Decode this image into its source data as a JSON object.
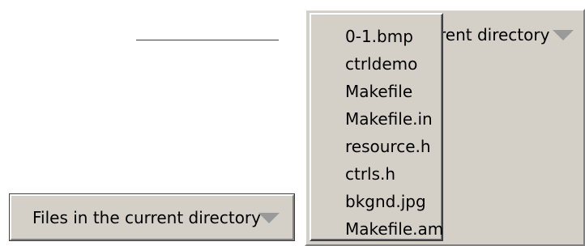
{
  "closed_dropdown": {
    "label": "Files in the current directory",
    "arrow_icon": "triangle-down-icon"
  },
  "open_dropdown": {
    "label_visible": "rent directory",
    "arrow_icon": "triangle-down-icon",
    "items": [
      {
        "label": "0-1.bmp"
      },
      {
        "label": "ctrldemo"
      },
      {
        "label": "Makefile"
      },
      {
        "label": "Makefile.in"
      },
      {
        "label": "resource.h"
      },
      {
        "label": "ctrls.h"
      },
      {
        "label": "bkgnd.jpg"
      },
      {
        "label": "Makefile.am"
      }
    ]
  },
  "colors": {
    "face": "#d4d0c8",
    "highlight": "#ffffff",
    "shadow": "#808080",
    "dark_shadow": "#404040",
    "arrow": "#9a9a9a",
    "text": "#000000"
  }
}
